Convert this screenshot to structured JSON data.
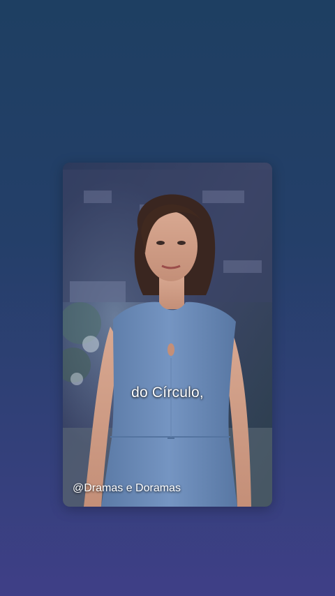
{
  "video": {
    "subtitle": "do Círculo,",
    "watermark": "@Dramas e Doramas"
  },
  "colors": {
    "background_top": "#1e3f62",
    "background_bottom": "#3f3f87",
    "dress": "#6e8fbd"
  }
}
